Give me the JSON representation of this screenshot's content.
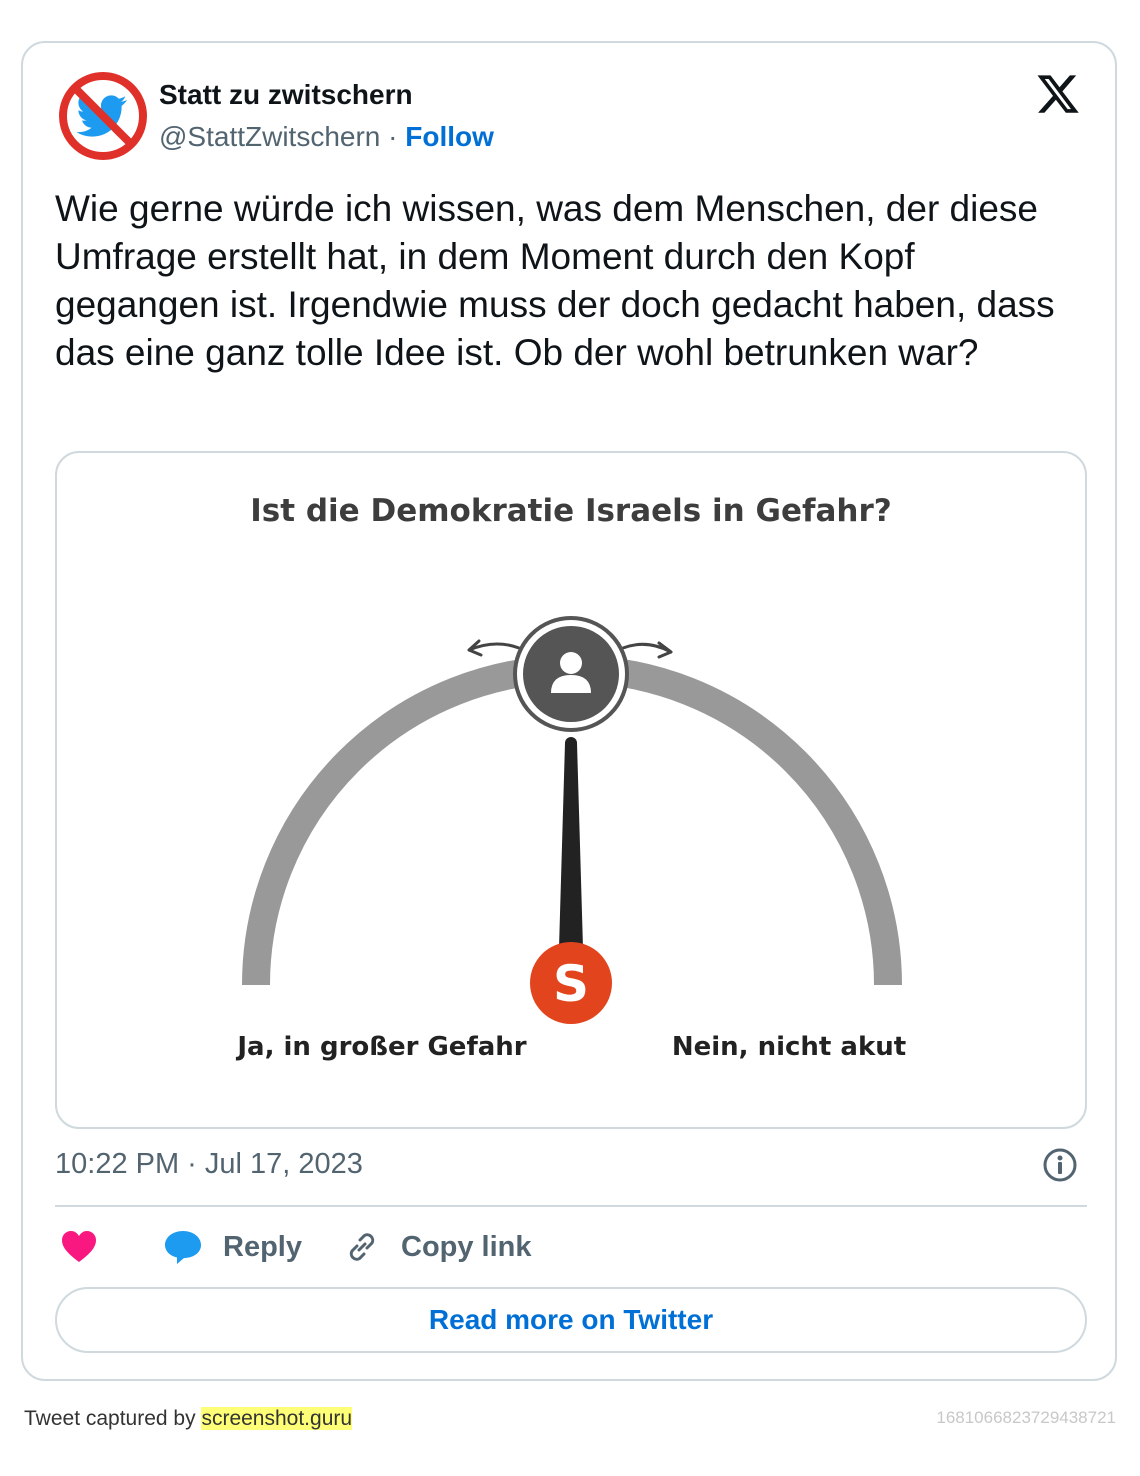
{
  "tweet": {
    "display_name": "Statt zu zwitschern",
    "handle": "@StattZwitschern",
    "separator": "·",
    "follow_label": "Follow",
    "text": "Wie gerne würde ich wissen, was dem Menschen, der diese Umfrage erstellt hat, in dem Moment durch den Kopf gegangen ist. Irgendwie muss der doch gedacht haben, dass das eine ganz tolle Idee ist. Ob der wohl betrunken war?",
    "timestamp": "10:22 PM · Jul 17, 2023"
  },
  "media": {
    "title": "Ist die Demokratie Israels in Gefahr?",
    "left_label": "Ja, in großer Gefahr",
    "right_label": "Nein, nicht akut",
    "badge_letter": "S",
    "colors": {
      "arc": "#999999",
      "knob": "#555555",
      "needle": "#222222",
      "badge": "#e2451d"
    }
  },
  "actions": {
    "reply_label": "Reply",
    "copy_link_label": "Copy link",
    "read_more_label": "Read more on Twitter"
  },
  "footer": {
    "captured_prefix": "Tweet captured by",
    "captured_site": "screenshot.guru",
    "tweet_id": "1681066823729438721"
  },
  "colors": {
    "link": "#006fd6",
    "like": "#f91880",
    "reply": "#1d9bf0",
    "border": "#cfd9de"
  }
}
